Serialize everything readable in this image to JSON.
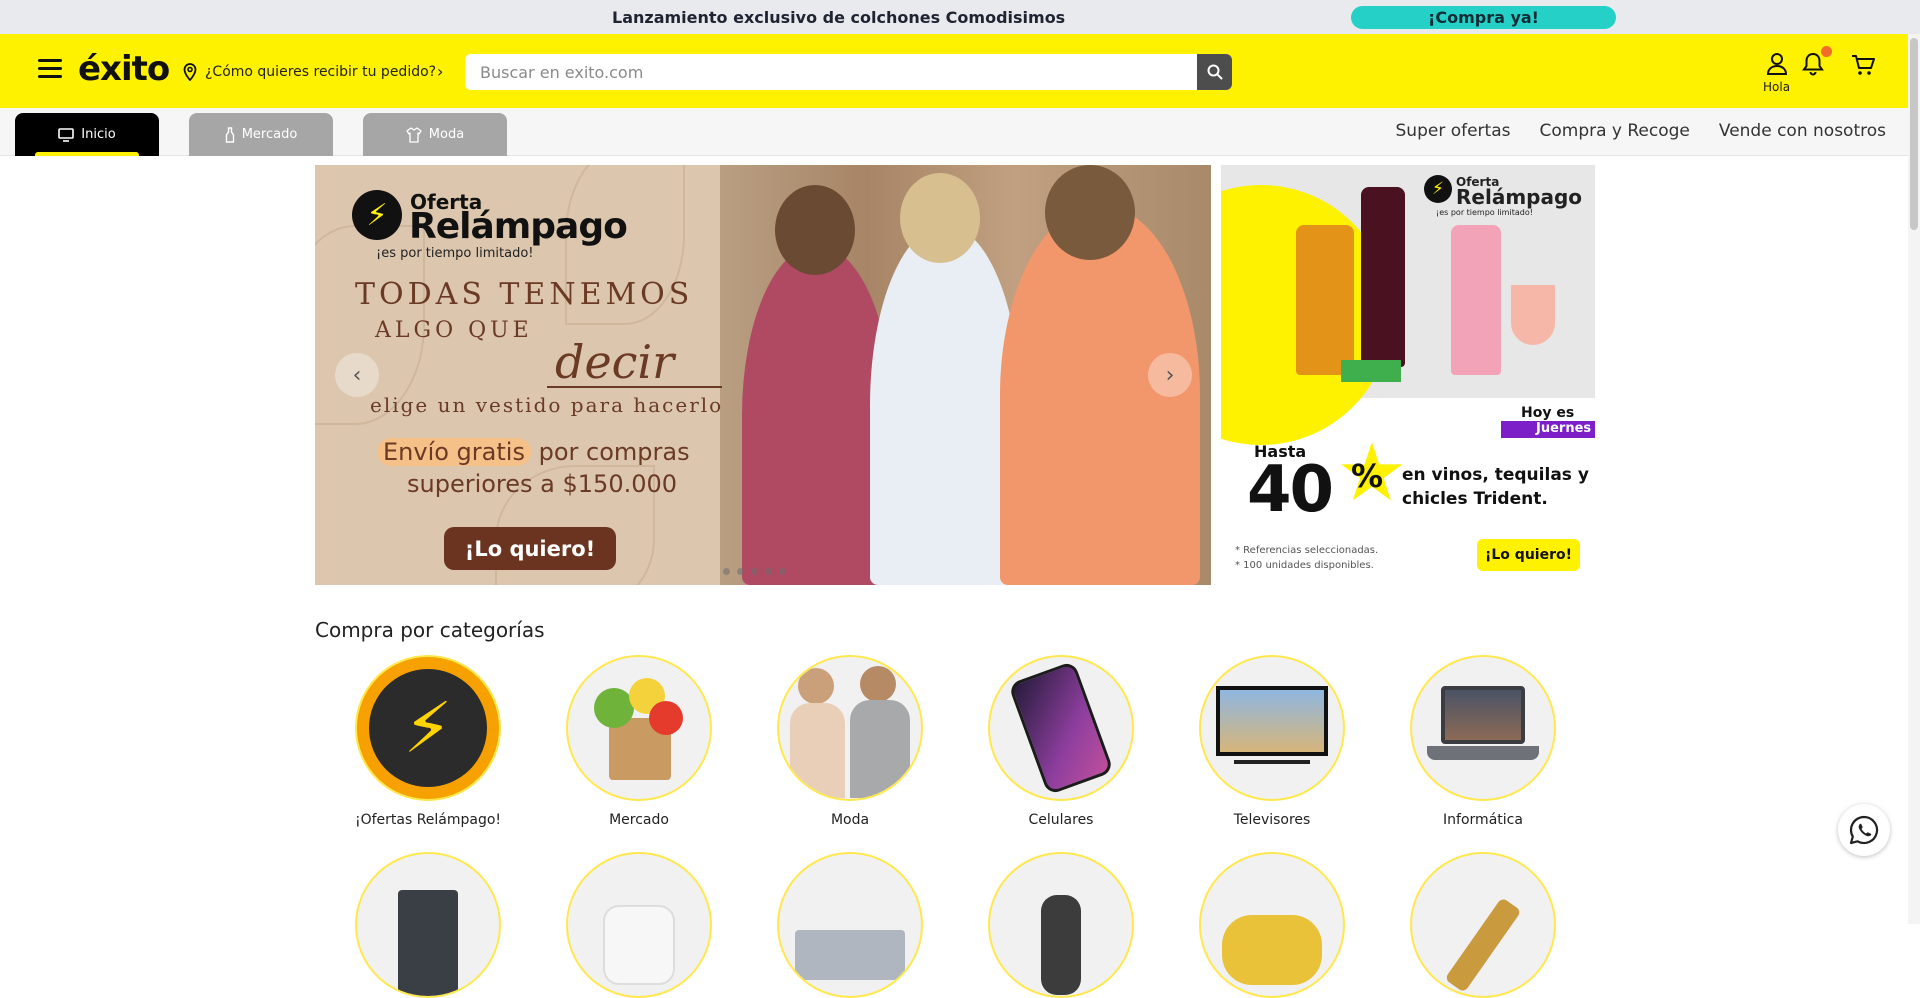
{
  "announcement": {
    "text": "Lanzamiento exclusivo de colchones Comodisimos",
    "cta": "¡Compra ya!"
  },
  "header": {
    "logo_text": "éxito",
    "delivery_prompt": "¿Cómo quieres recibir tu pedido?",
    "search_placeholder": "Buscar en exito.com",
    "account_label": "Hola",
    "icons": [
      "menu-icon",
      "location-pin-icon",
      "search-icon",
      "user-icon",
      "bell-icon",
      "cart-icon"
    ],
    "brand_color": "#fff200"
  },
  "nav": {
    "tabs": [
      {
        "label": "Inicio",
        "icon": "monitor-icon",
        "active": true
      },
      {
        "label": "Mercado",
        "icon": "bottle-icon",
        "active": false
      },
      {
        "label": "Moda",
        "icon": "shirt-icon",
        "active": false
      }
    ],
    "links": [
      "Super ofertas",
      "Compra y Recoge",
      "Vende con nosotros"
    ]
  },
  "hero": {
    "offer_label": "Oferta",
    "offer_title": "Relámpago",
    "offer_sub": "¡es por tiempo limitado!",
    "headline_1": "TODAS TENEMOS",
    "headline_2": "ALGO QUE",
    "headline_script": "decir",
    "headline_3": "elige un vestido para hacerlo",
    "shipping_highlight": "Envío gratis",
    "shipping_rest": "por compras",
    "shipping_line2": "superiores a $150.000",
    "cta": "¡Lo quiero!"
  },
  "side_banner": {
    "offer_label": "Oferta",
    "offer_title": "Relámpago",
    "offer_sub": "¡es por tiempo limitado!",
    "day_line1": "Hoy es",
    "day_line2": "Juernes",
    "hasta": "Hasta",
    "percent": "40",
    "percent_sign": "%",
    "desc_line1": "en vinos, tequilas y",
    "desc_line2": "chicles Trident.",
    "fine_1": "* Referencias seleccionadas.",
    "fine_2": "* 100 unidades disponibles.",
    "cta": "¡Lo quiero!"
  },
  "categories": {
    "title": "Compra por categorías",
    "items": [
      {
        "label": "¡Ofertas Relámpago!",
        "color": "#f5a300"
      },
      {
        "label": "Mercado",
        "color": "#7cbf3c"
      },
      {
        "label": "Moda",
        "color": "#d9b59a"
      },
      {
        "label": "Celulares",
        "color": "#6a3b9a"
      },
      {
        "label": "Televisores",
        "color": "#2c2c2c"
      },
      {
        "label": "Informática",
        "color": "#585d66"
      }
    ]
  }
}
